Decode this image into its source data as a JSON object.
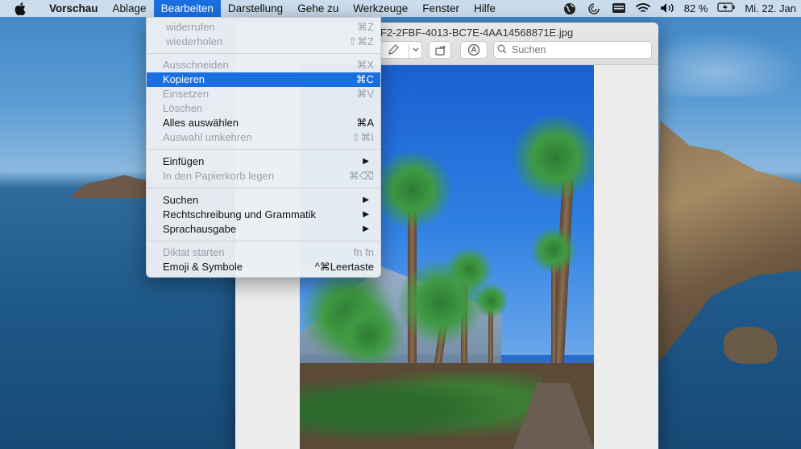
{
  "menubar": {
    "app_name": "Vorschau",
    "items": [
      "Ablage",
      "Bearbeiten",
      "Darstellung",
      "Gehe zu",
      "Werkzeuge",
      "Fenster",
      "Hilfe"
    ],
    "active_item": "Bearbeiten",
    "battery_percent": "82 %",
    "clock": "Mi. 22. Jan"
  },
  "window": {
    "title": "F2-2FBF-4013-BC7E-4AA14568871E.jpg",
    "search_placeholder": "Suchen"
  },
  "edit_menu": {
    "undo": {
      "label": "widerrufen",
      "shortcut": "⌘Z"
    },
    "redo": {
      "label": "wiederholen",
      "shortcut": "⇧⌘Z"
    },
    "cut": {
      "label": "Ausschneiden",
      "shortcut": "⌘X"
    },
    "copy": {
      "label": "Kopieren",
      "shortcut": "⌘C"
    },
    "paste": {
      "label": "Einsetzen",
      "shortcut": "⌘V"
    },
    "delete": {
      "label": "Löschen",
      "shortcut": ""
    },
    "select_all": {
      "label": "Alles auswählen",
      "shortcut": "⌘A"
    },
    "invert_selection": {
      "label": "Auswahl umkehren",
      "shortcut": "⇧⌘I"
    },
    "insert": {
      "label": "Einfügen"
    },
    "move_to_trash": {
      "label": "In den Papierkorb legen",
      "shortcut": "⌘⌫"
    },
    "find": {
      "label": "Suchen"
    },
    "spelling": {
      "label": "Rechtschreibung und Grammatik"
    },
    "speech": {
      "label": "Sprachausgabe"
    },
    "dictation": {
      "label": "Diktat starten",
      "shortcut": "fn fn"
    },
    "emoji": {
      "label": "Emoji & Symbole",
      "shortcut": "^⌘Leertaste"
    }
  },
  "colors": {
    "accent": "#1a6fe0",
    "disabled_text": "#9aa0a6"
  }
}
